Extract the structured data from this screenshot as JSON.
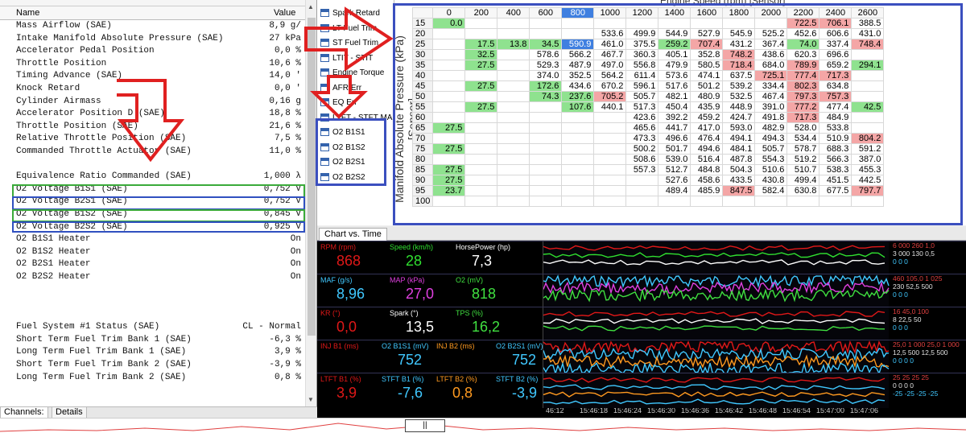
{
  "params": {
    "col_name": "Name",
    "col_value": "Value",
    "rows": [
      [
        "Mass Airflow (SAE)",
        "8,9 g/"
      ],
      [
        "Intake Manifold Absolute Pressure (SAE)",
        "27 kPa"
      ],
      [
        "Accelerator Pedal Position",
        "0,0 %"
      ],
      [
        "Throttle Position",
        "10,6 %"
      ],
      [
        "Timing Advance (SAE)",
        "14,0 '"
      ],
      [
        "Knock Retard",
        "0,0 '"
      ],
      [
        "Cylinder Airmass",
        "0,16 g"
      ],
      [
        "Accelerator Position D (SAE)",
        "18,8 %"
      ],
      [
        "Throttle Position (SAE)",
        "21,6 %"
      ],
      [
        "Relative Throttle Position (SAE)",
        "7,5 %"
      ],
      [
        "Commanded Throttle Actuator (SAE)",
        "11,0 %"
      ],
      [
        "",
        ""
      ],
      [
        "Equivalence Ratio Commanded (SAE)",
        "1,000 λ"
      ],
      [
        "O2 Voltage B1S1 (SAE)",
        "0,752 V"
      ],
      [
        "O2 Voltage B2S1 (SAE)",
        "0,752 V"
      ],
      [
        "O2 Voltage B1S2 (SAE)",
        "0,845 V"
      ],
      [
        "O2 Voltage B2S2 (SAE)",
        "0,925 V"
      ],
      [
        "O2 B1S1 Heater",
        "On"
      ],
      [
        "O2 B1S2 Heater",
        "On"
      ],
      [
        "O2 B2S1 Heater",
        "On"
      ],
      [
        "O2 B2S2 Heater",
        "On"
      ],
      [
        "",
        ""
      ],
      [
        "",
        ""
      ],
      [
        "",
        ""
      ],
      [
        "Fuel System #1 Status (SAE)",
        "CL - Normal"
      ],
      [
        "Short Term Fuel Trim Bank 1 (SAE)",
        "-6,3 %"
      ],
      [
        "Long Term Fuel Trim Bank 1 (SAE)",
        "3,9 %"
      ],
      [
        "Short Term Fuel Trim Bank 2 (SAE)",
        "-3,9 %"
      ],
      [
        "Long Term Fuel Trim Bank 2 (SAE)",
        "0,8 %"
      ]
    ]
  },
  "tabs": {
    "channels": "Channels:",
    "details": "Details"
  },
  "channel_list": [
    "Spark Retard",
    "LT Fuel Trim",
    "ST Fuel Trim",
    "LTIT - STIT",
    "Engine Torque",
    "AFR Err",
    "EQ Err",
    "LTFT - STFT MAF",
    "O2 B1S1",
    "O2 B1S2",
    "O2 B2S1",
    "O2 B2S2"
  ],
  "table": {
    "x_title": "Engine Speed (rpm) [Sensor]",
    "y_title": "Manifold Absolute Pressure (kPa) [Sensor]",
    "cols": [
      "0",
      "200",
      "400",
      "600",
      "800",
      "1000",
      "1200",
      "1400",
      "1600",
      "1800",
      "2000",
      "2200",
      "2400",
      "2600"
    ],
    "rows": [
      {
        "k": "15",
        "v": [
          "0.0",
          "",
          "",
          "",
          "",
          "",
          "",
          "",
          "",
          "",
          "",
          "722.5",
          "706.1",
          "388.5"
        ]
      },
      {
        "k": "20",
        "v": [
          "",
          "",
          "",
          "",
          "",
          "533.6",
          "499.9",
          "544.9",
          "527.9",
          "545.9",
          "525.2",
          "452.6",
          "606.6",
          "431.0"
        ]
      },
      {
        "k": "25",
        "v": [
          "",
          "17.5",
          "13.8",
          "34.5",
          "590.9",
          "461.0",
          "375.5",
          "259.2",
          "707.4",
          "431.2",
          "367.4",
          "74.0",
          "337.4",
          "748.4"
        ]
      },
      {
        "k": "30",
        "v": [
          "",
          "32.5",
          "",
          "578.6",
          "566.2",
          "467.7",
          "360.3",
          "405.1",
          "352.8",
          "748.2",
          "438.6",
          "620.3",
          "696.6",
          ""
        ]
      },
      {
        "k": "35",
        "v": [
          "",
          "27.5",
          "",
          "529.3",
          "487.9",
          "497.0",
          "556.8",
          "479.9",
          "580.5",
          "718.4",
          "684.0",
          "789.9",
          "659.2",
          "294.1"
        ]
      },
      {
        "k": "40",
        "v": [
          "",
          "",
          "",
          "374.0",
          "352.5",
          "564.2",
          "611.4",
          "573.6",
          "474.1",
          "637.5",
          "725.1",
          "777.4",
          "717.3",
          ""
        ]
      },
      {
        "k": "45",
        "v": [
          "",
          "27.5",
          "",
          "172.6",
          "434.6",
          "670.2",
          "596.1",
          "517.6",
          "501.2",
          "539.2",
          "334.4",
          "802.3",
          "634.8",
          ""
        ]
      },
      {
        "k": "50",
        "v": [
          "",
          "",
          "",
          "74.3",
          "237.6",
          "705.2",
          "505.7",
          "482.1",
          "480.9",
          "532.5",
          "467.4",
          "797.3",
          "757.3",
          ""
        ]
      },
      {
        "k": "55",
        "v": [
          "",
          "27.5",
          "",
          "",
          "107.6",
          "440.1",
          "517.3",
          "450.4",
          "435.9",
          "448.9",
          "391.0",
          "777.2",
          "477.4",
          "42.5"
        ]
      },
      {
        "k": "60",
        "v": [
          "",
          "",
          "",
          "",
          "",
          "",
          "423.6",
          "392.2",
          "459.2",
          "424.7",
          "491.8",
          "717.3",
          "484.9",
          ""
        ]
      },
      {
        "k": "65",
        "v": [
          "27.5",
          "",
          "",
          "",
          "",
          "",
          "465.6",
          "441.7",
          "417.0",
          "593.0",
          "482.9",
          "528.0",
          "533.8",
          ""
        ]
      },
      {
        "k": "70",
        "v": [
          "",
          "",
          "",
          "",
          "",
          "",
          "473.3",
          "496.6",
          "476.4",
          "494.1",
          "494.3",
          "534.4",
          "510.9",
          "804.2"
        ]
      },
      {
        "k": "75",
        "v": [
          "27.5",
          "",
          "",
          "",
          "",
          "",
          "500.2",
          "501.7",
          "494.6",
          "484.1",
          "505.7",
          "578.7",
          "688.3",
          "591.2"
        ]
      },
      {
        "k": "80",
        "v": [
          "",
          "",
          "",
          "",
          "",
          "",
          "508.6",
          "539.0",
          "516.4",
          "487.8",
          "554.3",
          "519.2",
          "566.3",
          "387.0"
        ]
      },
      {
        "k": "85",
        "v": [
          "27.5",
          "",
          "",
          "",
          "",
          "",
          "557.3",
          "512.7",
          "484.8",
          "504.3",
          "510.6",
          "510.7",
          "538.3",
          "455.3"
        ]
      },
      {
        "k": "90",
        "v": [
          "27.5",
          "",
          "",
          "",
          "",
          "",
          "",
          "527.6",
          "458.6",
          "433.5",
          "430.8",
          "499.4",
          "451.5",
          "442.5"
        ]
      },
      {
        "k": "95",
        "v": [
          "23.7",
          "",
          "",
          "",
          "",
          "",
          "",
          "489.4",
          "485.9",
          "847.5",
          "582.4",
          "630.8",
          "677.5",
          "797.7"
        ]
      },
      {
        "k": "100",
        "v": [
          "",
          "",
          "",
          "",
          "",
          "",
          "",
          "",
          "",
          "",
          "",
          "",
          "",
          ""
        ]
      }
    ]
  },
  "chart": {
    "tab": "Chart vs. Time",
    "rows": [
      {
        "g": [
          {
            "l": "RPM (rpm)",
            "v": "868",
            "c": "#e01818"
          },
          {
            "l": "Speed (km/h)",
            "v": "28",
            "c": "#30e030"
          },
          {
            "l": "HorsePower (hp)",
            "v": "7,3",
            "c": "#ffffff"
          }
        ],
        "s": [
          "6 000 260 1,0",
          "3 000 130 0,5",
          "0 0 0"
        ]
      },
      {
        "g": [
          {
            "l": "MAF (g/s)",
            "v": "8,96",
            "c": "#40c8ff"
          },
          {
            "l": "MAP (kPa)",
            "v": "27,0",
            "c": "#e040e0"
          },
          {
            "l": "O2 (mV)",
            "v": "818",
            "c": "#40e040"
          }
        ],
        "s": [
          "460 105,0 1 025",
          "230 52,5 500",
          "0 0 0"
        ]
      },
      {
        "g": [
          {
            "l": "KR (°)",
            "v": "0,0",
            "c": "#e01818"
          },
          {
            "l": "Spark (°)",
            "v": "13,5",
            "c": "#ffffff"
          },
          {
            "l": "TPS (%)",
            "v": "16,2",
            "c": "#40e040"
          }
        ],
        "s": [
          "16 45,0 100",
          "8 22,5 50",
          "0 0 0"
        ]
      },
      {
        "g": [
          {
            "l": "INJ B1 (ms)",
            "v": "",
            "c": "#e01818"
          },
          {
            "l": "O2 B1S1 (mV)",
            "v": "752",
            "c": "#40c8ff"
          },
          {
            "l": "INJ B2 (ms)",
            "v": "",
            "c": "#ff9a20"
          },
          {
            "l": "O2 B2S1 (mV)",
            "v": "752",
            "c": "#40c8ff"
          }
        ],
        "s": [
          "25,0 1 000 25,0 1 000",
          "12,5 500 12,5 500",
          "0 0 0 0"
        ]
      },
      {
        "g": [
          {
            "l": "LTFT B1 (%)",
            "v": "3,9",
            "c": "#e01818"
          },
          {
            "l": "STFT B1 (%)",
            "v": "-7,6",
            "c": "#40c8ff"
          },
          {
            "l": "LTFT B2 (%)",
            "v": "0,8",
            "c": "#ff9a20"
          },
          {
            "l": "STFT B2 (%)",
            "v": "-3,9",
            "c": "#40c8ff"
          }
        ],
        "s": [
          "25 25 25 25",
          "0 0 0 0",
          "-25 -25 -25 -25"
        ]
      }
    ],
    "times": [
      "46:12",
      "15:46:18",
      "15:46:24",
      "15:46:30",
      "15:46:36",
      "15:46:42",
      "15:46:48",
      "15:46:54",
      "15:47:00",
      "15:47:06"
    ]
  }
}
